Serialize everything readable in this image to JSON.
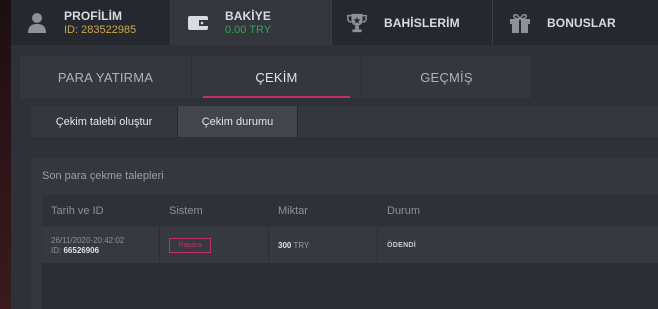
{
  "nav": {
    "profile": {
      "title": "PROFİLİM",
      "sub": "ID: 283522985"
    },
    "balance": {
      "title": "BAKİYE",
      "sub": "0.00 TRY"
    },
    "bets": {
      "title": "BAHİSLERİM"
    },
    "bonus": {
      "title": "BONUSLAR"
    }
  },
  "tabs": [
    "PARA YATIRMA",
    "ÇEKİM",
    "GEÇMİŞ"
  ],
  "active_tab": "ÇEKİM",
  "subtabs": [
    "Çekim talebi oluştur",
    "Çekim durumu"
  ],
  "active_subtab": "Çekim durumu",
  "section": {
    "title": "Son para çekme talepleri",
    "columns": [
      "Tarih ve ID",
      "Sistem",
      "Miktar",
      "Durum"
    ],
    "rows": [
      {
        "date": "26/11/2020-20:42:02",
        "id_label": "ID:",
        "id": "66526906",
        "system": "Papara",
        "amount": "300",
        "currency": "TRY",
        "status": "ÖDENDİ"
      }
    ]
  },
  "colors": {
    "accent": "#c2306a",
    "gold": "#d4a64a",
    "green": "#2ba84a"
  }
}
